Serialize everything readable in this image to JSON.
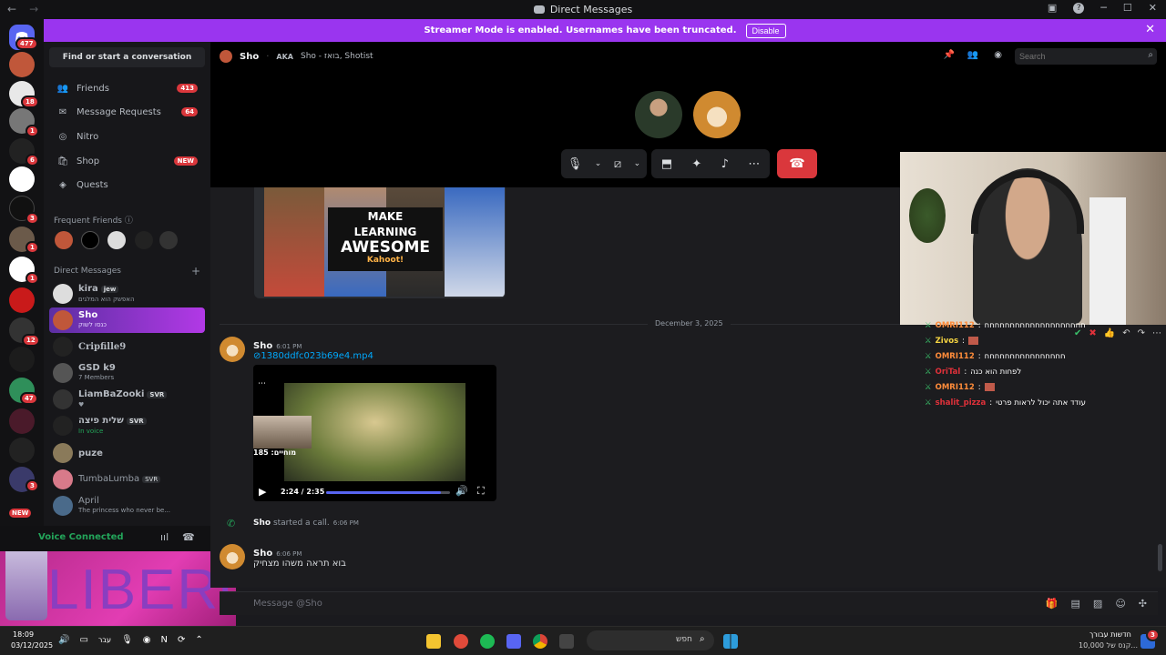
{
  "window": {
    "title": "Direct Messages"
  },
  "banner": {
    "text": "Streamer Mode is enabled. Usernames have been truncated.",
    "button": "Disable"
  },
  "rail": {
    "badges": [
      "477",
      "18",
      "1",
      "6",
      "1",
      "3",
      "1",
      "1",
      "12",
      "47",
      "3"
    ],
    "new_badge": "NEW"
  },
  "sidebar": {
    "find": "Find or start a conversation",
    "nav": [
      {
        "label": "Friends",
        "count": "413"
      },
      {
        "label": "Message Requests",
        "count": "64"
      },
      {
        "label": "Nitro"
      },
      {
        "label": "Shop",
        "count": "NEW"
      },
      {
        "label": "Quests"
      }
    ],
    "frequent_friends": "Frequent Friends",
    "direct_messages": "Direct Messages",
    "dms": [
      {
        "name": "kira",
        "tag": "jew",
        "sub": "האפשק הוא המלגים"
      },
      {
        "name": "Sho",
        "sub": "כנסו לשוק"
      },
      {
        "name": "Cripfille9",
        "sub": ""
      },
      {
        "name": "GSD k9",
        "sub": "7 Members"
      },
      {
        "name": "LiamBaZooki",
        "tag": "SVR",
        "sub": ""
      },
      {
        "name": "שלית פיצה",
        "tag": "SVR",
        "sub": "In voice"
      },
      {
        "name": "puze",
        "sub": ""
      },
      {
        "name": "TumbaLumba",
        "tag": "SVR",
        "sub": ""
      },
      {
        "name": "April",
        "sub": "The princess who never be..."
      }
    ],
    "voice_connected": "Voice Connected",
    "overlay_text": "LIBERO"
  },
  "header": {
    "name": "Sho",
    "aka": "AKA",
    "aka_names": "Sho - בואז, Shotist",
    "search_placeholder": "Search"
  },
  "chat": {
    "date_divider": "December 3, 2025",
    "promo": {
      "line1": "MAKE",
      "line2": "LEARNING",
      "line3": "AWESOME",
      "brand": "Kahoot!"
    },
    "msg1": {
      "author": "Sho",
      "time": "6:01 PM",
      "file": "1380ddfc023b69e4.mp4"
    },
    "video": {
      "time": "2:24 / 2:35",
      "overlay": "מוחיים: 185",
      "progress": 0.93
    },
    "call_event": {
      "author": "Sho",
      "text": "started a call.",
      "time": "6:06 PM"
    },
    "msg2": {
      "author": "Sho",
      "time": "6:06 PM",
      "text": "בוא תראה משהו מצחיק"
    },
    "input_placeholder": "Message @Sho"
  },
  "twitch": [
    {
      "user": "OMRI112",
      "text": "חחחחחחחחחחחחחחחחחחחח",
      "color": "#ff8c3a"
    },
    {
      "user": "Zivos",
      "text": "",
      "color": "#f5d442"
    },
    {
      "user": "OMRI112",
      "text": "חחחחחחחחחחחחחחחח",
      "color": "#ff8c3a"
    },
    {
      "user": "OriTal",
      "text": "לפחות הוא כנה",
      "color": "#e0313a"
    },
    {
      "user": "OMRI112",
      "text": "",
      "color": "#ff8c3a"
    },
    {
      "user": "shalit_pizza",
      "text": "עודד אתה יכול לראות פרטי",
      "color": "#e0313a"
    }
  ],
  "taskbar": {
    "time": "18:09",
    "date": "03/12/2025",
    "lang": "עבר",
    "search": "חפש",
    "news_title": "חדשות עבורך",
    "news_sub": "קנס של 10,000...",
    "news_badge": "3"
  }
}
